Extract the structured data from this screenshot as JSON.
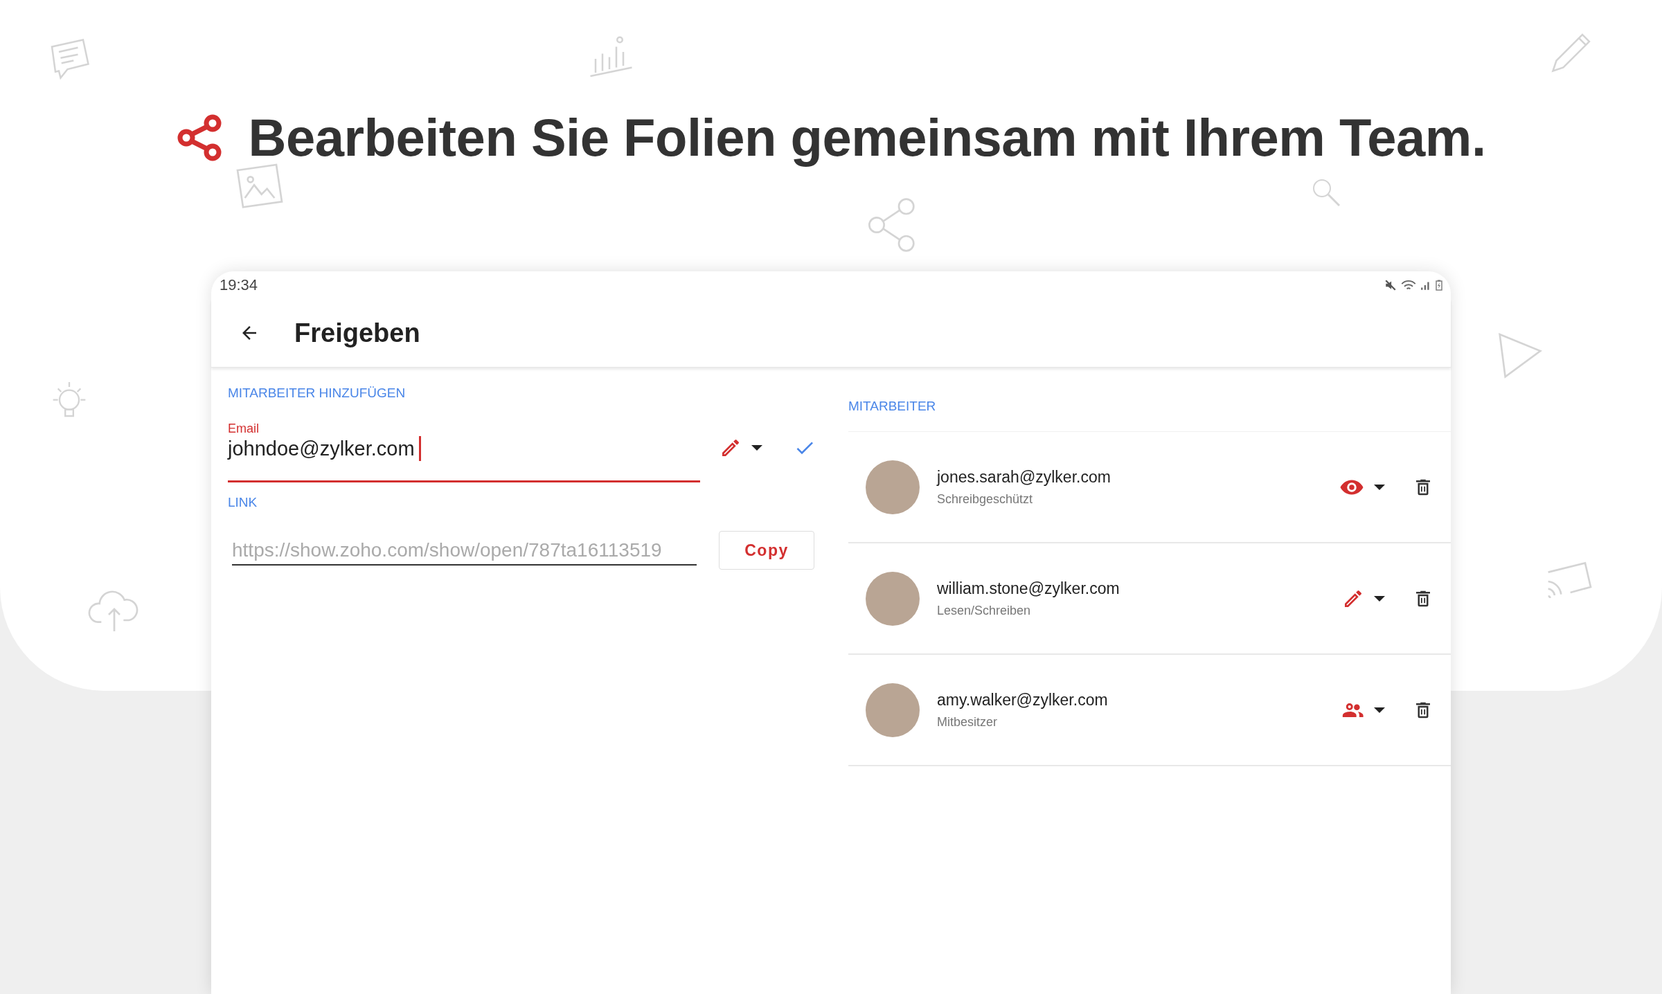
{
  "headline": "Bearbeiten Sie Folien gemeinsam mit Ihrem Team.",
  "status_bar": {
    "time": "19:34"
  },
  "toolbar": {
    "title": "Freigeben"
  },
  "add_collaborator": {
    "heading": "MITARBEITER HINZUFÜGEN",
    "email_field": {
      "label": "Email",
      "value": "johndoe@zylker.com",
      "kind": "edit"
    },
    "link_heading": "LINK",
    "link_field": {
      "value": "https://show.zoho.com/show/open/787ta16113519"
    },
    "copy_button": "Copy"
  },
  "collaborators": {
    "heading": "MITARBEITER",
    "items": [
      {
        "email": "jones.sarah@zylker.com",
        "role": "Schreibgeschützt",
        "kind": "view"
      },
      {
        "email": "william.stone@zylker.com",
        "role": "Lesen/Schreiben",
        "kind": "edit"
      },
      {
        "email": "amy.walker@zylker.com",
        "role": "Mitbesitzer",
        "kind": "coowner"
      }
    ]
  }
}
